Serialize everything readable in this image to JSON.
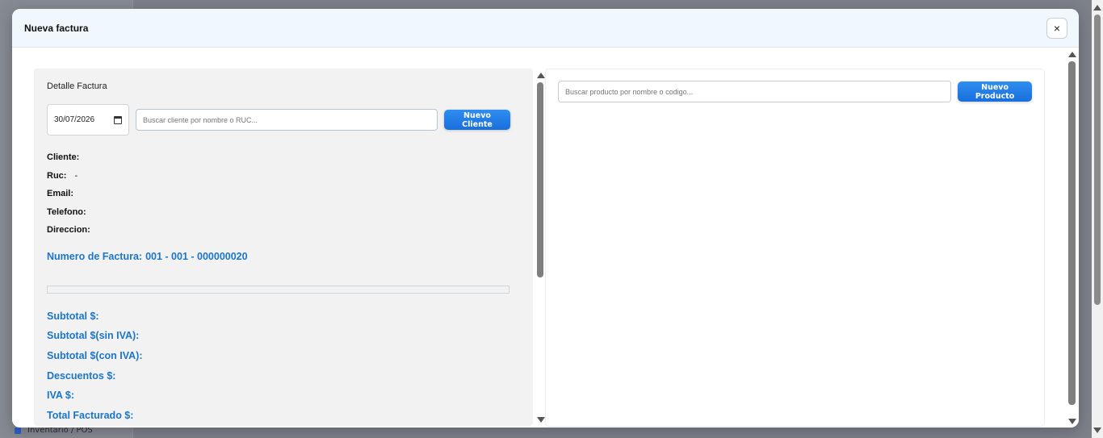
{
  "background": {
    "sidebar_bottom_item": "Inventario / POS"
  },
  "modal": {
    "title": "Nueva factura",
    "close_glyph": "×"
  },
  "left_panel": {
    "section_title": "Detalle Factura",
    "date_value": "30/07/2026",
    "client_search_placeholder": "Buscar cliente por nombre o RUC...",
    "new_client_label": "Nuevo Cliente",
    "client_fields": [
      {
        "label": "Cliente:",
        "value": ""
      },
      {
        "label": "Ruc:",
        "value": "-"
      },
      {
        "label": "Email:",
        "value": ""
      },
      {
        "label": "Telefono:",
        "value": ""
      },
      {
        "label": "Direccion:",
        "value": ""
      }
    ],
    "invoice_number_label": "Numero de Factura:",
    "invoice_number_value": "001 - 001 - 000000020",
    "totals": [
      {
        "label": "Subtotal $:",
        "value": ""
      },
      {
        "label": "Subtotal $(sin IVA):",
        "value": ""
      },
      {
        "label": "Subtotal $(con IVA):",
        "value": ""
      },
      {
        "label": "Descuentos $:",
        "value": ""
      },
      {
        "label": "IVA $:",
        "value": ""
      },
      {
        "label": "Total Facturado $:",
        "value": ""
      }
    ]
  },
  "right_panel": {
    "product_search_placeholder": "Buscar producto por nombre o codigo...",
    "new_product_label": "Nuevo Producto"
  },
  "colors": {
    "accent": "#1b75c9",
    "button": "#1a6fdc",
    "header_bg": "#f0f7fd"
  }
}
